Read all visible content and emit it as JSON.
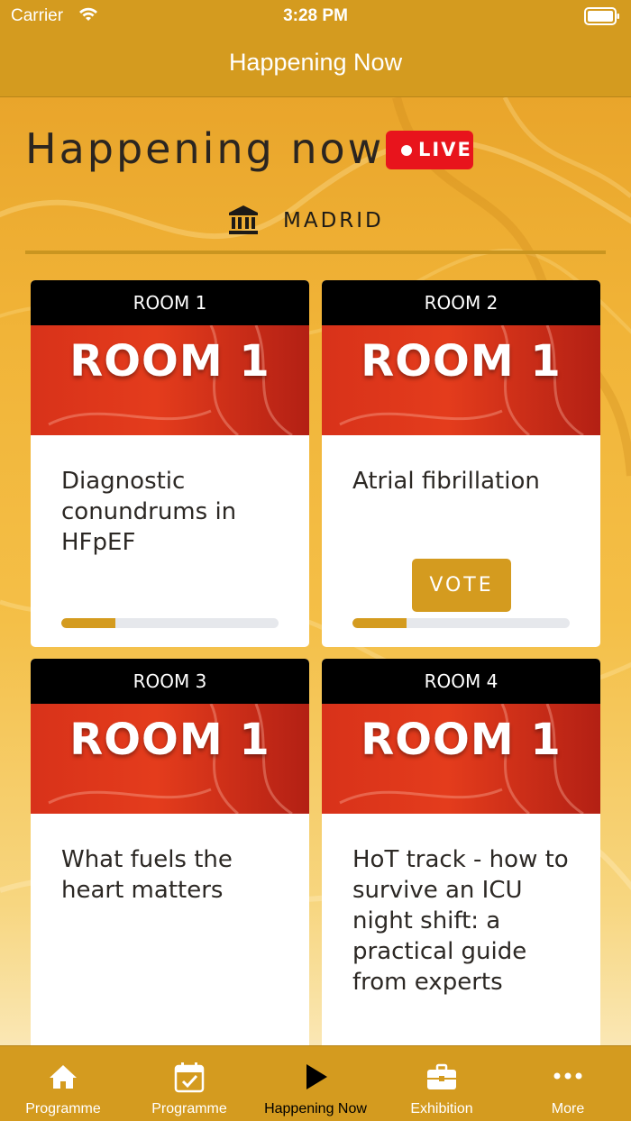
{
  "status_bar": {
    "carrier": "Carrier",
    "time": "3:28 PM"
  },
  "nav": {
    "title": "Happening Now"
  },
  "main": {
    "heading": "Happening now",
    "live_badge": "LIVE",
    "venue": {
      "name": "MADRID",
      "icon": "building-columns-icon"
    }
  },
  "rooms": [
    {
      "label": "ROOM 1",
      "banner": "ROOM 1",
      "session": "Diagnostic conundrums in HFpEF",
      "progress": 0.25
    },
    {
      "label": "ROOM 2",
      "banner": "ROOM 1",
      "session": "Atrial fibrillation",
      "progress": 0.25,
      "vote_label": "VOTE"
    },
    {
      "label": "ROOM 3",
      "banner": "ROOM 1",
      "session": "What fuels the heart matters"
    },
    {
      "label": "ROOM 4",
      "banner": "ROOM 1",
      "session": "HoT track - how to survive an ICU night shift: a practical guide from experts"
    }
  ],
  "tabs": [
    {
      "label": "Programme",
      "icon": "home-icon"
    },
    {
      "label": "Programme",
      "icon": "calendar-check-icon"
    },
    {
      "label": "Happening Now",
      "icon": "play-icon",
      "active": true
    },
    {
      "label": "Exhibition",
      "icon": "briefcase-icon"
    },
    {
      "label": "More",
      "icon": "more-dots-icon"
    }
  ],
  "colors": {
    "brand": "#d49b1f",
    "live": "#e8141c",
    "banner": "#e43c1c"
  }
}
